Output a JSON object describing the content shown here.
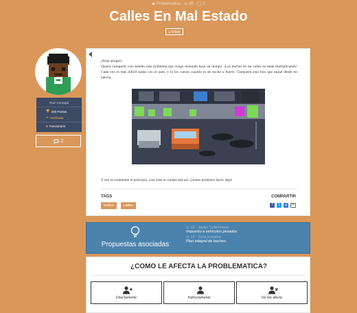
{
  "header": {
    "meta": "◆ Problematica · ◎ 35 · ◯ 2",
    "title": "Calles En Mal Estado",
    "back_label": "◂ Volver"
  },
  "author": {
    "name": "Ruiz Consejal",
    "points": "280 Puntos",
    "verified": "Verificado",
    "role": "Funcionario",
    "comments_count": "2"
  },
  "post": {
    "greeting": "¡Hola amigos!",
    "body": "Quería compartir con ustedes este problema que vengo teniendo hace un tiempo. ¡Los baches en las calles se están multiplicando! Cada vez es más difícil andar con el auto, y ni les cuento cuando es de noche o llueve. Chequeen esta foto que saqué desde mi balcón.",
    "closing": "Y eso es solamente el principio, casi toda la ciudad está así. ¡Juntos podemos hacer algo!",
    "tags_label": "TAGS",
    "tags": [
      "trafico",
      "calles"
    ],
    "share_label": "COMPARTIR"
  },
  "proposals": {
    "label": "Propuestas asociadas",
    "items": [
      {
        "meta": "◎ 10 · Jaider Soltermana",
        "title": "Impuesto a vehículos pesados"
      },
      {
        "meta": "◎ 12 · Cora Irnoidea",
        "title": "Plan integral de bacheo"
      }
    ]
  },
  "afecta": {
    "heading": "¿COMO LE AFECTA LA PROBLEMATICA?",
    "options": [
      "Directamente",
      "Indirectamente",
      "No me afecta"
    ]
  },
  "colors": {
    "background": "#d9975a",
    "accent_blue": "#4b83ad",
    "card_dark": "#3d4a63"
  }
}
